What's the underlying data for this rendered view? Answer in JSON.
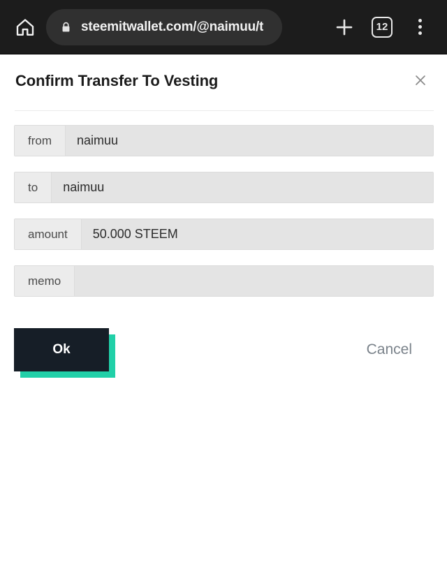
{
  "browser": {
    "home_icon": "home-icon",
    "lock_icon": "lock-icon",
    "url": "steemitwallet.com/@naimuu/t",
    "new_tab_icon": "plus-icon",
    "tab_count": "12",
    "menu_icon": "overflow-menu-icon",
    "bar_background": "#1c1c1c",
    "pill_background": "#303030"
  },
  "dialog": {
    "title": "Confirm Transfer To Vesting",
    "close_icon": "close-icon",
    "fields": [
      {
        "label": "from",
        "value": "naimuu"
      },
      {
        "label": "to",
        "value": "naimuu"
      },
      {
        "label": "amount",
        "value": "50.000 STEEM"
      },
      {
        "label": "memo",
        "value": ""
      }
    ],
    "actions": {
      "confirm_label": "Ok",
      "cancel_label": "Cancel",
      "confirm_color": "#161e27",
      "confirm_shadow_color": "#21d0a8",
      "cancel_color": "#7a828a"
    }
  }
}
